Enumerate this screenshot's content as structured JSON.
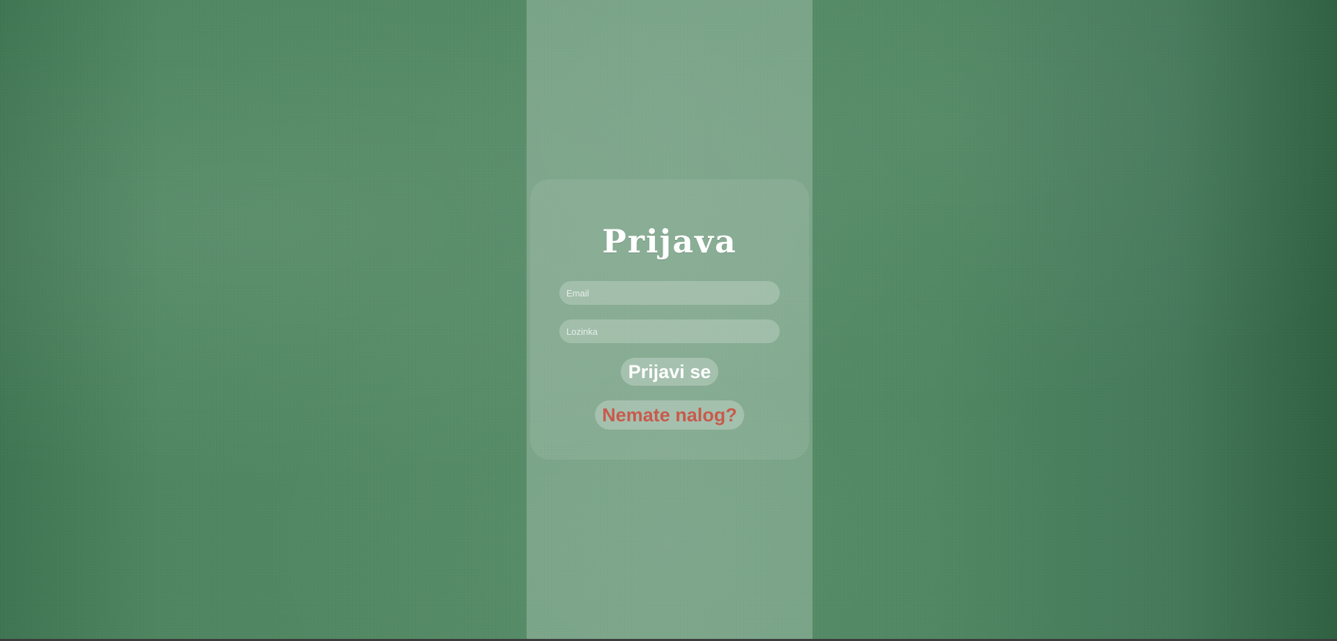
{
  "page": {
    "background_color": "#528863"
  },
  "login": {
    "title": "Prijava",
    "email_placeholder": "Email",
    "password_placeholder": "Lozinka",
    "submit_label": "Prijavi se",
    "register_label": "Nemate nalog?"
  },
  "colors": {
    "title": "#ffffff",
    "submit_text": "#ffffff",
    "register_text": "#c85a4d"
  }
}
